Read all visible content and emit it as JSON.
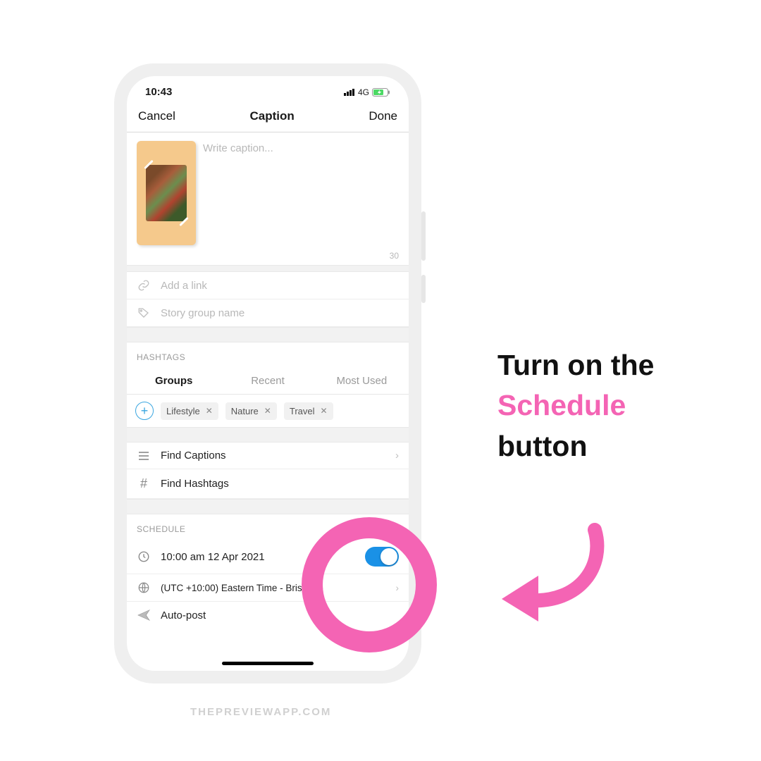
{
  "status": {
    "time": "10:43",
    "network": "4G"
  },
  "nav": {
    "cancel": "Cancel",
    "title": "Caption",
    "done": "Done"
  },
  "caption": {
    "placeholder": "Write caption...",
    "charCount": "30"
  },
  "link": {
    "placeholder": "Add a link"
  },
  "storyGroup": {
    "placeholder": "Story group name"
  },
  "hashtags": {
    "sectionLabel": "HASHTAGS",
    "tabs": {
      "groups": "Groups",
      "recent": "Recent",
      "mostUsed": "Most Used"
    },
    "chips": [
      "Lifestyle",
      "Nature",
      "Travel"
    ]
  },
  "find": {
    "captions": "Find Captions",
    "hashtags": "Find Hashtags"
  },
  "schedule": {
    "sectionLabel": "SCHEDULE",
    "datetime": "10:00 am  12 Apr 2021",
    "timezone": "(UTC +10:00) Eastern Time - Brisbane",
    "autopost": "Auto-post"
  },
  "annotation": {
    "line1": "Turn on the",
    "line2": "Schedule",
    "line3": "button"
  },
  "watermark": "THEPREVIEWAPP.COM",
  "colors": {
    "pink": "#f464b4",
    "toggleBlue": "#1a91e6"
  }
}
